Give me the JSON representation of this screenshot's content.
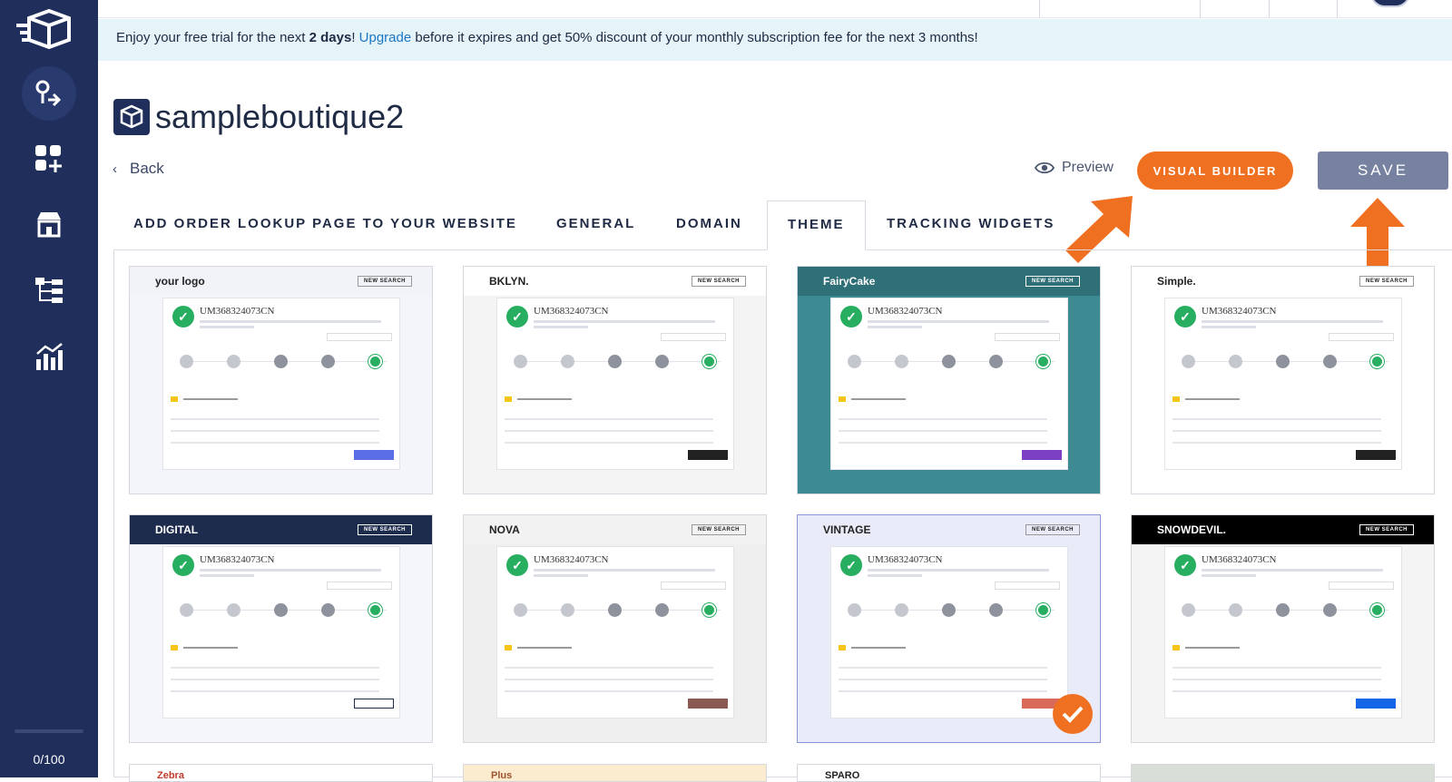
{
  "sidebar": {
    "items": [
      {
        "icon": "route-icon",
        "active": true
      },
      {
        "icon": "apps-icon",
        "active": false
      },
      {
        "icon": "store-icon",
        "active": false
      },
      {
        "icon": "workflow-icon",
        "active": false
      },
      {
        "icon": "analytics-icon",
        "active": false
      }
    ],
    "counter": "0/100"
  },
  "trial_banner": {
    "prefix": "Enjoy your free trial for the next ",
    "days": "2 days",
    "bang": "! ",
    "upgrade": "Upgrade",
    "suffix": " before it expires and get 50% discount of your monthly subscription fee for the next 3 months!"
  },
  "store": {
    "name": "sampleboutique2"
  },
  "nav": {
    "back": "Back",
    "preview": "Preview"
  },
  "actions": {
    "visual_builder": "VISUAL BUILDER",
    "save": "SAVE"
  },
  "tabs": [
    {
      "label": "ADD ORDER LOOKUP PAGE TO YOUR WEBSITE",
      "active": false
    },
    {
      "label": "GENERAL",
      "active": false
    },
    {
      "label": "DOMAIN",
      "active": false
    },
    {
      "label": "THEME",
      "active": true
    },
    {
      "label": "TRACKING WIDGETS",
      "active": false
    }
  ],
  "themes": [
    {
      "name": "your logo",
      "tracking": "UM368324073CN",
      "header_bg": "#f1f3f8",
      "body_bg": "#f3f5fa",
      "button": "#5b6ee8",
      "new_search": "NEW SEARCH",
      "selected": false
    },
    {
      "name": "BKLYN.",
      "tracking": "UM368324073CN",
      "header_bg": "#ffffff",
      "body_bg": "#f4f4f4",
      "button": "#222222",
      "new_search": "NEW SEARCH",
      "selected": false
    },
    {
      "name": "FairyCake",
      "tracking": "UM368324073CN",
      "header_bg": "#2f6f78",
      "body_bg": "#3d8a93",
      "button": "#7b3fc4",
      "new_search": "NEW SEARCH",
      "selected": false
    },
    {
      "name": "Simple.",
      "tracking": "UM368324073CN",
      "header_bg": "#ffffff",
      "body_bg": "#ffffff",
      "button": "#222222",
      "new_search": "NEW SEARCH",
      "selected": false
    },
    {
      "name": "DIGITAL",
      "tracking": "UM368324073CN",
      "header_bg": "#1d2b4d",
      "body_bg": "#f4f6fa",
      "button": "#ffffff",
      "new_search": "NEW SEARCH",
      "selected": false
    },
    {
      "name": "NOVA",
      "tracking": "UM368324073CN",
      "header_bg": "#f2f2f2",
      "body_bg": "#efefef",
      "button": "#8a5a52",
      "new_search": "NEW SEARCH",
      "selected": false
    },
    {
      "name": "VINTAGE",
      "tracking": "UM368324073CN",
      "header_bg": "#e9ecf8",
      "body_bg": "#e9ecf8",
      "button": "#d96a5a",
      "new_search": "NEW SEARCH",
      "selected": true
    },
    {
      "name": "SNOWDEVIL.",
      "tracking": "UM368324073CN",
      "header_bg": "#000000",
      "body_bg": "#f4f4f4",
      "button": "#1565e8",
      "new_search": "NEW SEARCH",
      "selected": false
    }
  ],
  "peek_themes": [
    {
      "name": "Zebra",
      "bg": "#ffffff",
      "color": "#c0392b"
    },
    {
      "name": "Plus",
      "bg": "#fbeccf",
      "color": "#a0522d"
    },
    {
      "name": "SPARO",
      "bg": "#ffffff",
      "color": "#222222"
    },
    {
      "name": "",
      "bg": "#d9dfd6",
      "color": "#333333"
    }
  ],
  "colors": {
    "sidebar": "#1f2e5b",
    "accent": "#f07021",
    "save": "#7782a1",
    "banner": "#e4f4f8",
    "link": "#1b76c9"
  }
}
